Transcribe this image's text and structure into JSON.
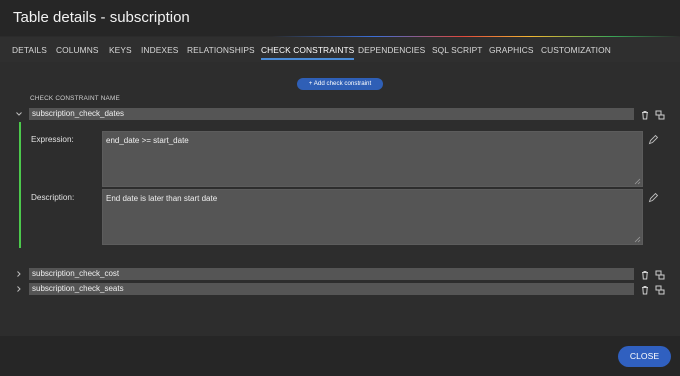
{
  "window": {
    "title": "Table details - subscription"
  },
  "tabs": [
    {
      "label": "DETAILS"
    },
    {
      "label": "COLUMNS"
    },
    {
      "label": "KEYS"
    },
    {
      "label": "INDEXES"
    },
    {
      "label": "RELATIONSHIPS"
    },
    {
      "label": "CHECK CONSTRAINTS",
      "active": true
    },
    {
      "label": "DEPENDENCIES"
    },
    {
      "label": "SQL SCRIPT"
    },
    {
      "label": "GRAPHICS"
    },
    {
      "label": "CUSTOMIZATION"
    }
  ],
  "add_button": {
    "label": "+ Add check constraint"
  },
  "section_label": "CHECK CONSTRAINT NAME",
  "constraints": [
    {
      "name": "subscription_check_dates",
      "expanded": true,
      "expression_label": "Expression:",
      "expression": "end_date >= start_date",
      "description_label": "Description:",
      "description": "End date is later than start date"
    },
    {
      "name": "subscription_check_cost",
      "expanded": false
    },
    {
      "name": "subscription_check_seats",
      "expanded": false
    }
  ],
  "footer": {
    "close_label": "CLOSE"
  },
  "colors": {
    "accent": "#3060c0",
    "expanded_marker": "#4cc94c",
    "active_tab_underline": "#4a8bd6"
  }
}
